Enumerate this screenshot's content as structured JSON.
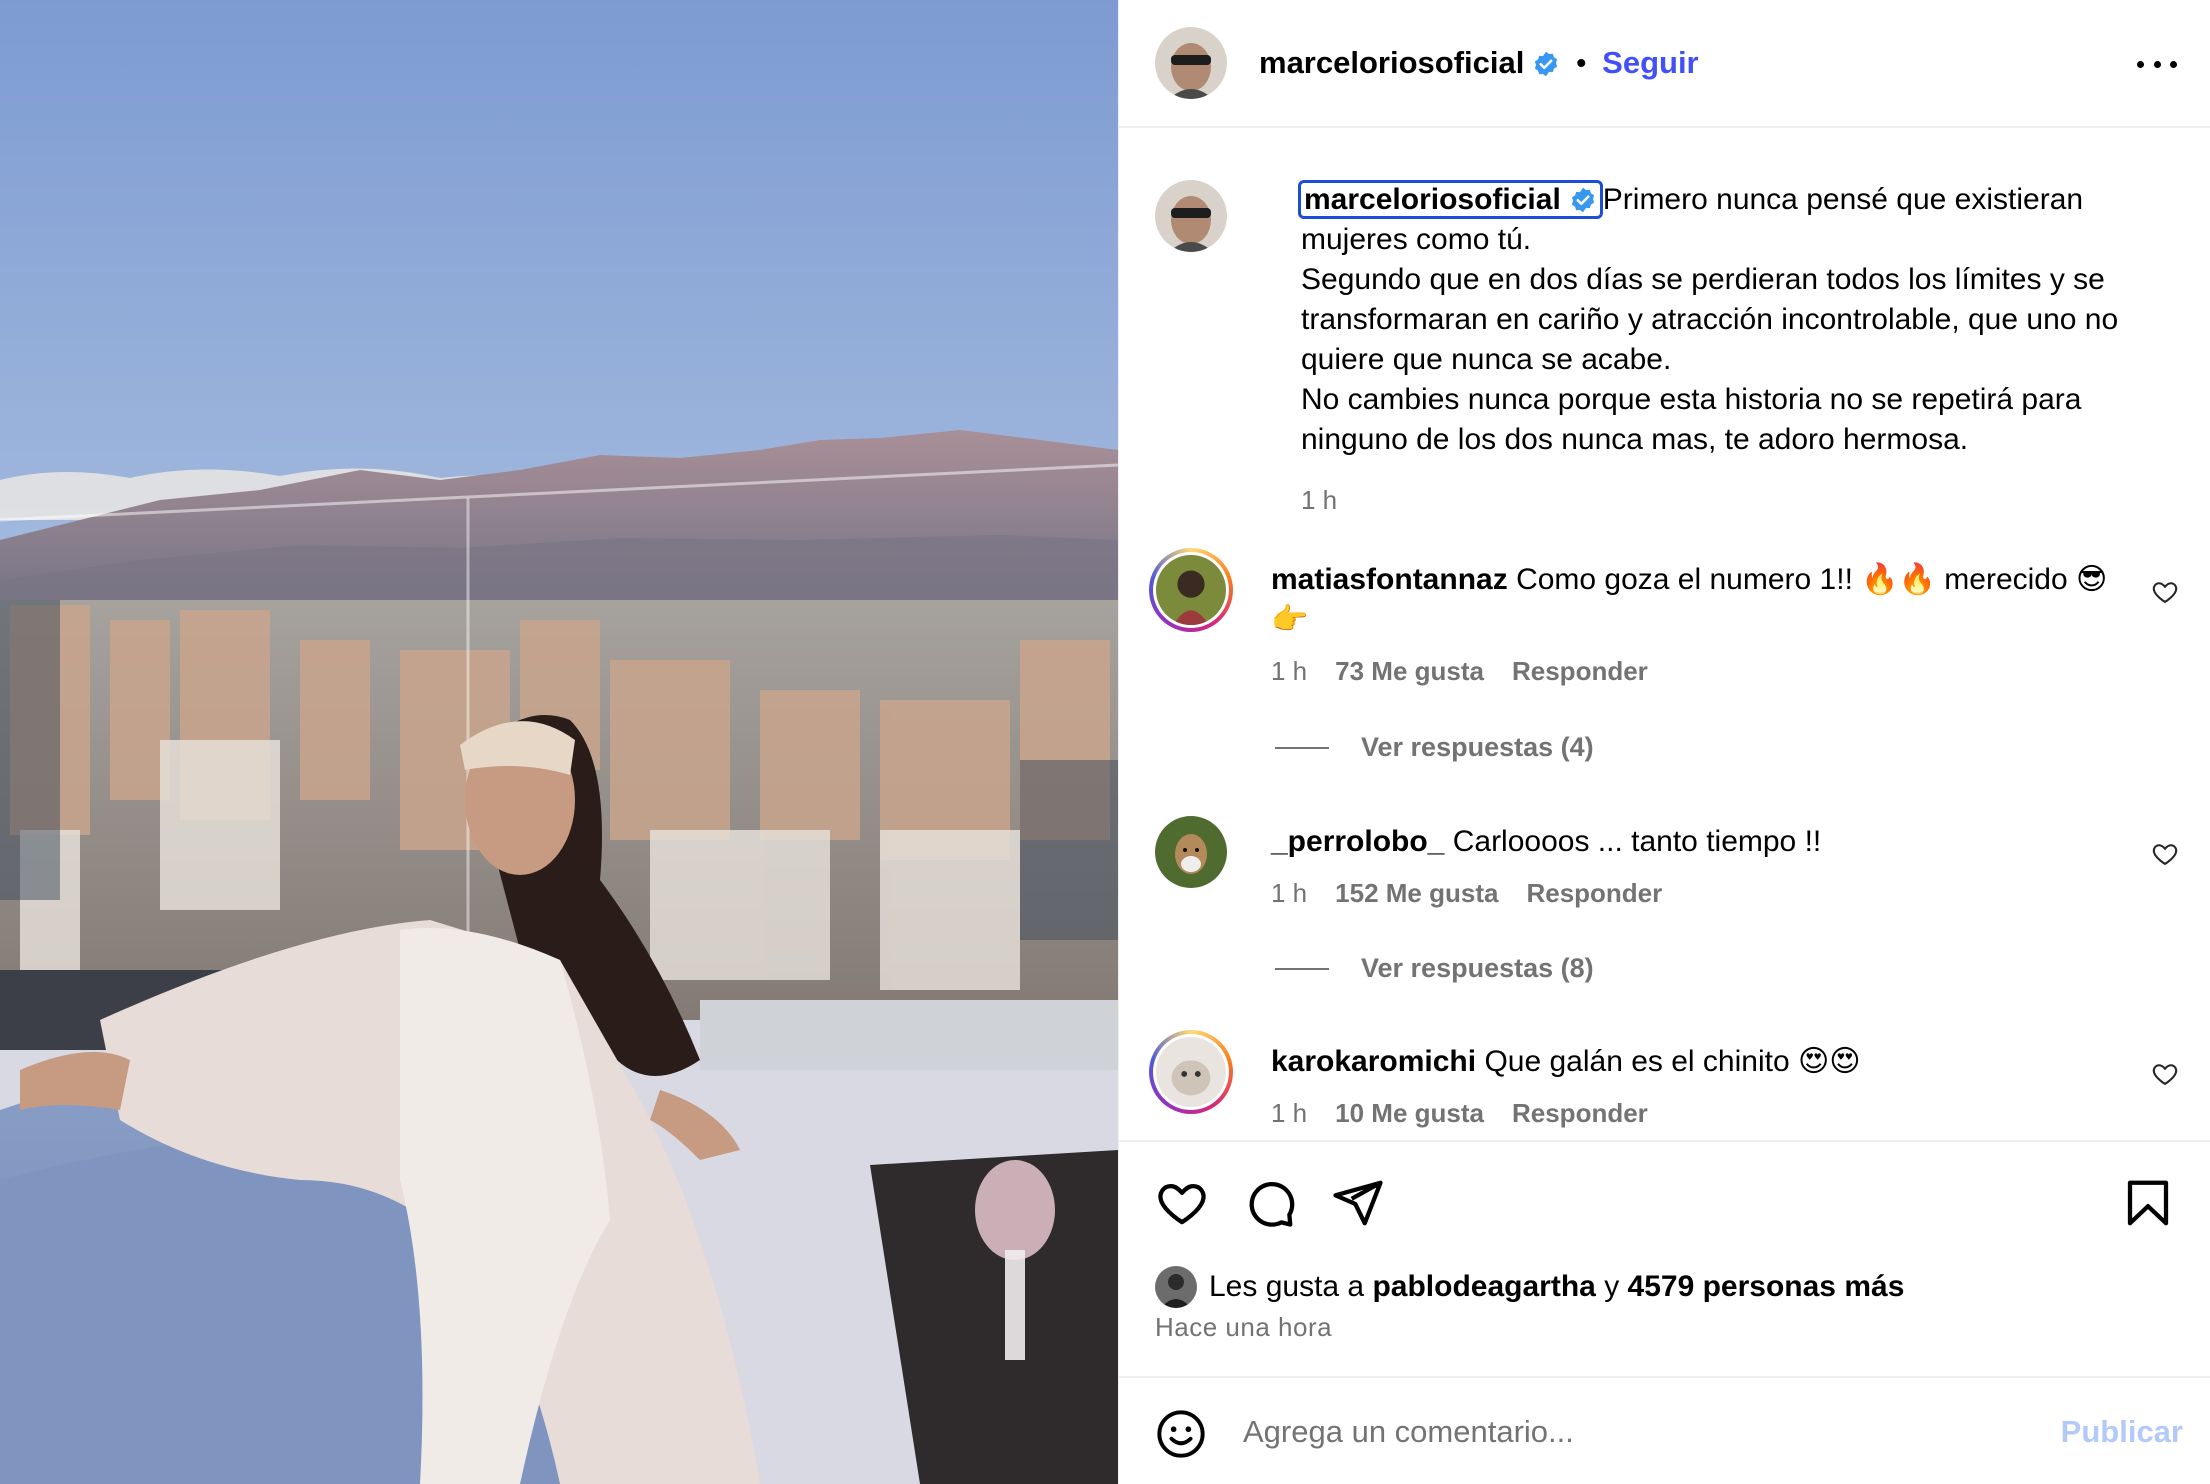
{
  "post_author": {
    "username": "marceloriosoficial",
    "verified": true,
    "follow_label": "Seguir",
    "separator": "•"
  },
  "caption": {
    "username": "marceloriosoficial",
    "lines": [
      "Primero nunca pensé que existieran",
      "mujeres como tú.",
      "Segundo que en dos días se perdieran todos los límites y se",
      "transformaran en cariño y atracción incontrolable, que uno no",
      "quiere que nunca se acabe.",
      "No cambies nunca porque esta historia no se repetirá para",
      "ninguno de los dos nunca mas, te adoro hermosa."
    ],
    "time": "1 h"
  },
  "comments": [
    {
      "username": "matiasfontannaz",
      "text": "Como goza el numero 1!! 🔥🔥 merecido 😎 👉",
      "time": "1 h",
      "likes": "73 Me gusta",
      "reply_label": "Responder",
      "view_replies": "Ver respuestas (4)"
    },
    {
      "username": "_perrolobo_",
      "text": "Carloooos ... tanto tiempo !!",
      "time": "1 h",
      "likes": "152 Me gusta",
      "reply_label": "Responder",
      "view_replies": "Ver respuestas (8)"
    },
    {
      "username": "karokaromichi",
      "text": "Que galán es el chinito 😍😍",
      "time": "1 h",
      "likes": "10 Me gusta",
      "reply_label": "Responder"
    }
  ],
  "likes_summary": {
    "prefix": "Les gusta a",
    "liker": "pablodeagartha",
    "connector": "y",
    "others": "4579 personas más"
  },
  "posted_time": "Hace una hora",
  "compose": {
    "placeholder": "Agrega un comentario...",
    "publish_label": "Publicar"
  },
  "icons": {
    "like": "heart-icon",
    "comment": "comment-bubble-icon",
    "share": "paper-plane-icon",
    "save": "bookmark-icon",
    "more": "more-horizontal-icon",
    "emoji": "smiley-icon",
    "verified": "verified-badge-icon"
  },
  "colors": {
    "follow": "#4150f7",
    "verified": "#3897f0",
    "secondary_text": "#737373",
    "publish_disabled": "#b3c9f9",
    "caption_username_outline": "#1d4ed8"
  }
}
